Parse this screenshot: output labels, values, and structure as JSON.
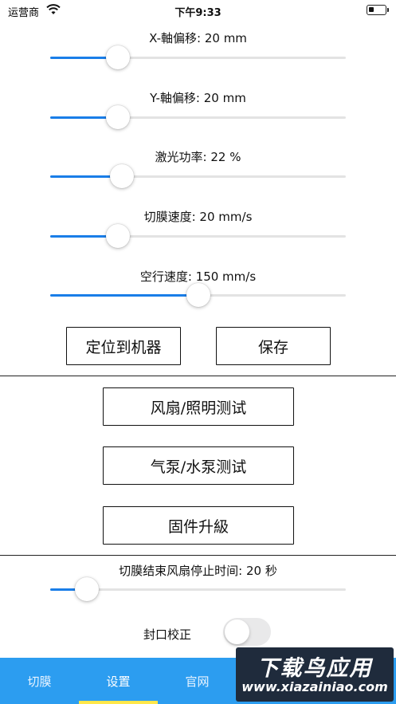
{
  "status_bar": {
    "carrier": "运营商",
    "time": "下午9:33",
    "wifi_icon": "wifi-icon",
    "battery_icon": "battery-icon",
    "battery_level": 0.3
  },
  "sliders": [
    {
      "label": "X-軸偏移: 20 mm",
      "level": 0.229
    },
    {
      "label": "Y-軸偏移: 20 mm",
      "level": 0.229
    },
    {
      "label": "激光功率: 22 %",
      "level": 0.242
    },
    {
      "label": "切膜速度: 20 mm/s",
      "level": 0.229
    },
    {
      "label": "空行速度: 150 mm/s",
      "level": 0.501
    }
  ],
  "buttons": {
    "locate": "定位到机器",
    "save": "保存",
    "fan_light_test": "风扇/照明测试",
    "pump_test": "气泵/水泵测试",
    "firmware_upgrade": "固件升級"
  },
  "fan_stop_slider": {
    "label": "切膜结束风扇停止时间: 20 秒",
    "level": 0.125
  },
  "seal_correction": {
    "label": "封口校正",
    "enabled": false
  },
  "tabs": [
    {
      "label": "切膜",
      "active": false
    },
    {
      "label": "设置",
      "active": true
    },
    {
      "label": "官网",
      "active": false
    }
  ],
  "colors": {
    "accent": "#1a7ee8",
    "tabbar": "#2c9df0",
    "tab_indicator": "#ffe74a"
  },
  "watermark": {
    "title": "下载鸟应用",
    "url": "www.xiazainiao.com"
  }
}
